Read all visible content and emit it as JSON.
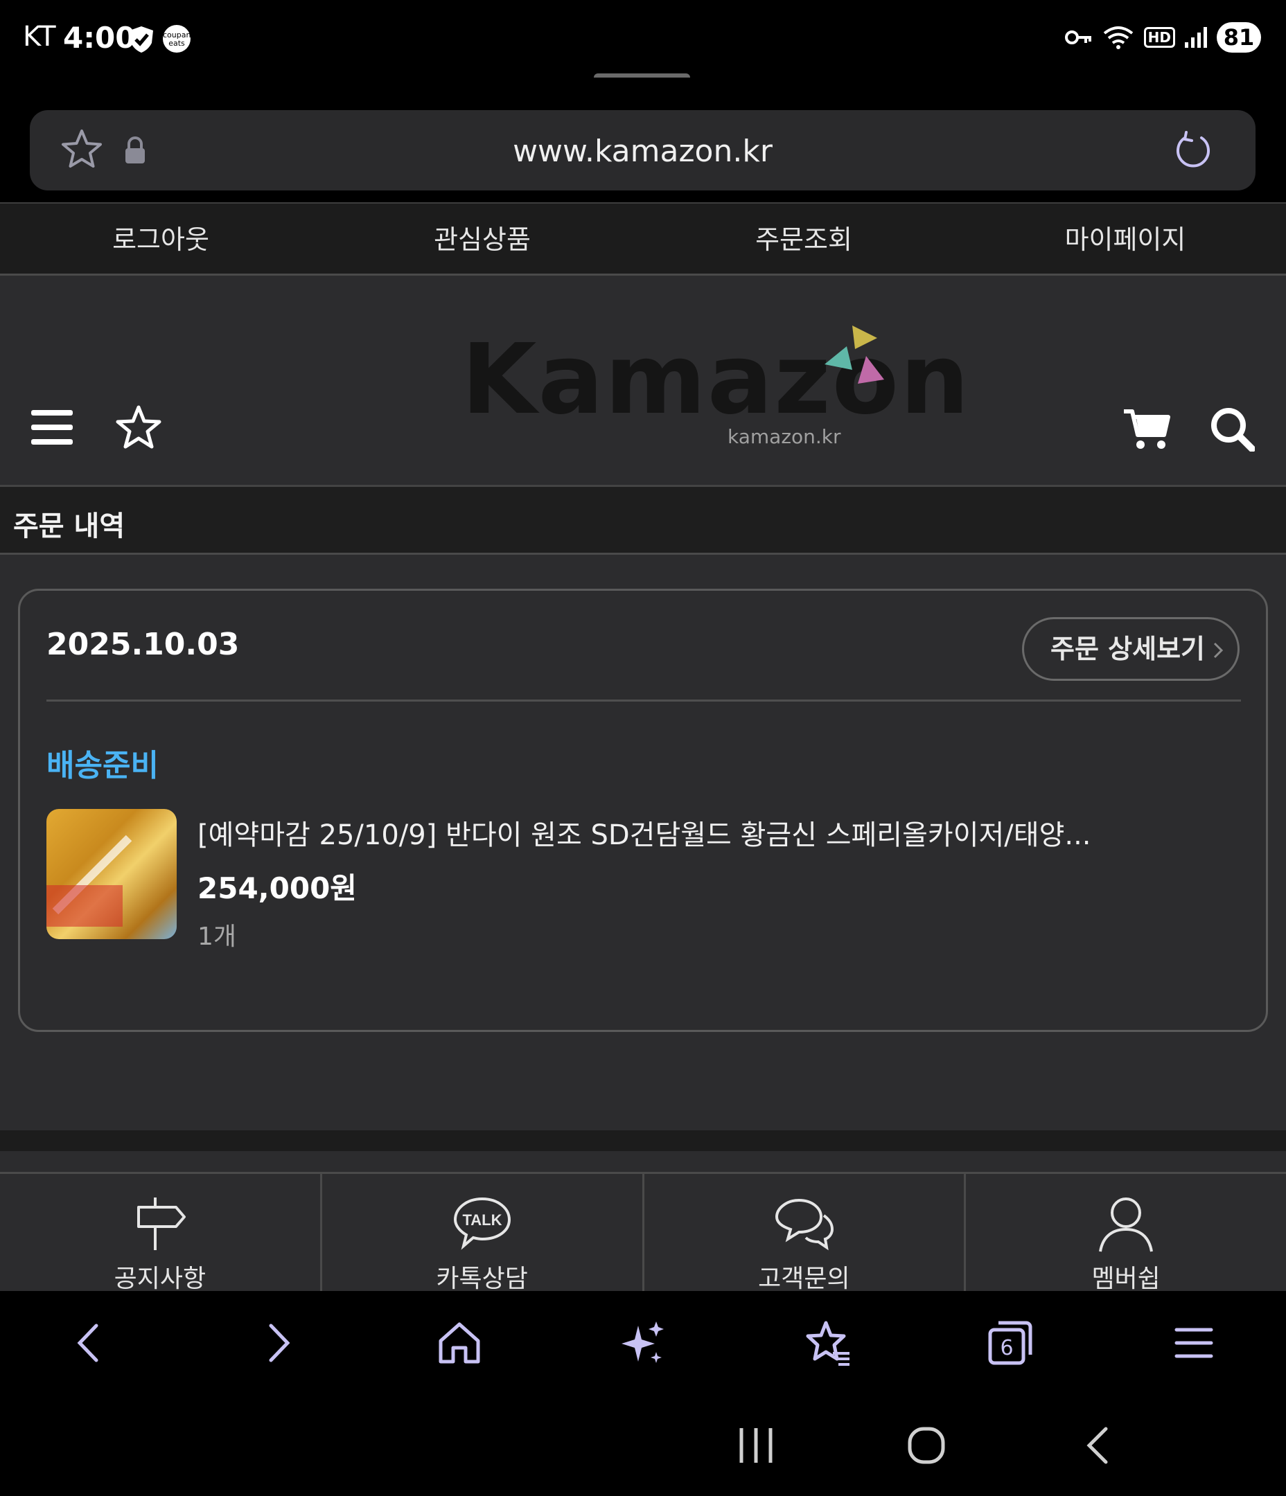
{
  "status_bar": {
    "carrier": "KT",
    "time": "4:00",
    "eats_badge": "coupang eats",
    "hd": "HD",
    "battery": "81"
  },
  "browser": {
    "url": "www.kamazon.kr",
    "tab_count": "6"
  },
  "top_nav": [
    "로그아웃",
    "관심상품",
    "주문조회",
    "마이페이지"
  ],
  "header": {
    "logo": "Kamazon",
    "logo_sub": "kamazon.kr",
    "colors": {
      "logo_yellow": "#c9b64a",
      "logo_teal": "#5fb8a8",
      "logo_pink": "#c06aa8"
    }
  },
  "section_title": "주문 내역",
  "order": {
    "date": "2025.10.03",
    "detail_button": "주문 상세보기",
    "status": "배송준비",
    "status_color": "#4ab3f4",
    "product_name": "[예약마감 25/10/9] 반다이 원조 SD건담월드 황금신 스페리올카이저/태양...",
    "price": "254,000원",
    "quantity": "1개"
  },
  "bottom_nav": [
    {
      "label": "공지사항",
      "icon": "signpost-icon"
    },
    {
      "label": "카톡상담",
      "icon": "kakao-talk-icon"
    },
    {
      "label": "고객문의",
      "icon": "chat-bubbles-icon"
    },
    {
      "label": "멤버쉽",
      "icon": "user-icon"
    }
  ],
  "talk_icon_text": "TALK"
}
